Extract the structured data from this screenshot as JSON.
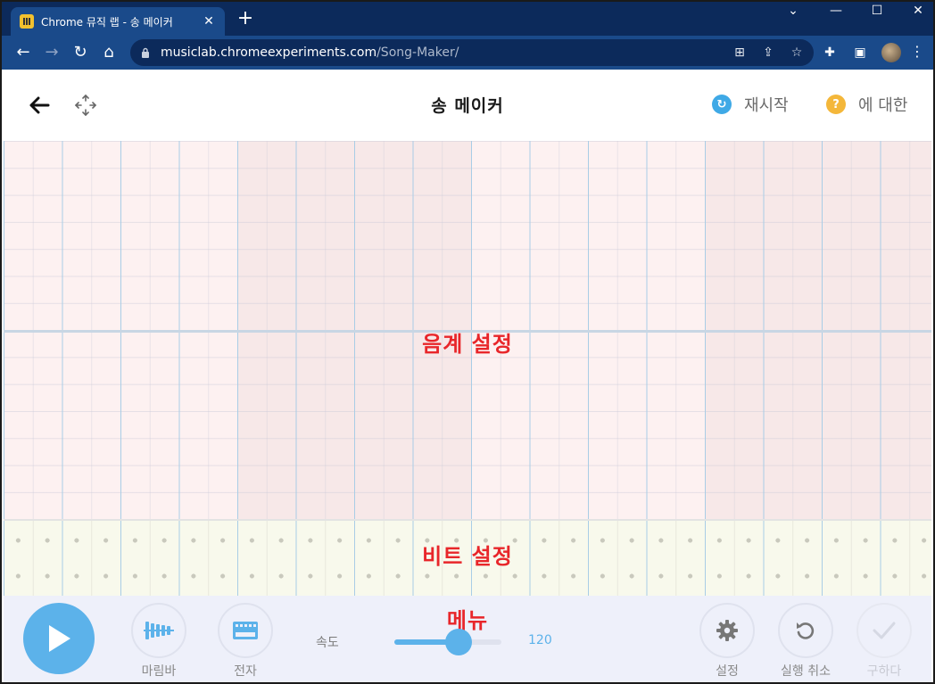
{
  "browser": {
    "tab_title": "Chrome 뮤직 랩 - 송 메이커",
    "url_host": "musiclab.chromeexperiments.com",
    "url_path": "/Song-Maker/"
  },
  "header": {
    "title": "송 메이커",
    "restart_label": "재시작",
    "about_label": "에 대한"
  },
  "annotations": {
    "melody": "음계 설정",
    "rhythm": "비트 설정",
    "menu": "메뉴"
  },
  "menu": {
    "marimba_label": "마림바",
    "electronic_label": "전자",
    "tempo_label": "속도",
    "tempo_value": "120",
    "tempo_fraction": 0.6,
    "settings_label": "설정",
    "undo_label": "실행 취소",
    "save_label": "구하다"
  },
  "colors": {
    "accent": "#5cb2ea",
    "annotation": "#e8262a",
    "melody_bg": "#fdf1f1",
    "rhythm_bg": "#f8f9ec",
    "restart_icon": "#3fa9e6",
    "about_icon": "#f4b73a"
  },
  "icons": {
    "back": "arrow-left-icon",
    "move": "move-arrows-icon",
    "restart": "refresh-icon",
    "about": "question-icon",
    "play": "play-icon",
    "marimba": "marimba-icon",
    "electronic": "keyboard-icon",
    "settings": "gear-icon",
    "undo": "undo-icon",
    "save": "check-icon"
  }
}
